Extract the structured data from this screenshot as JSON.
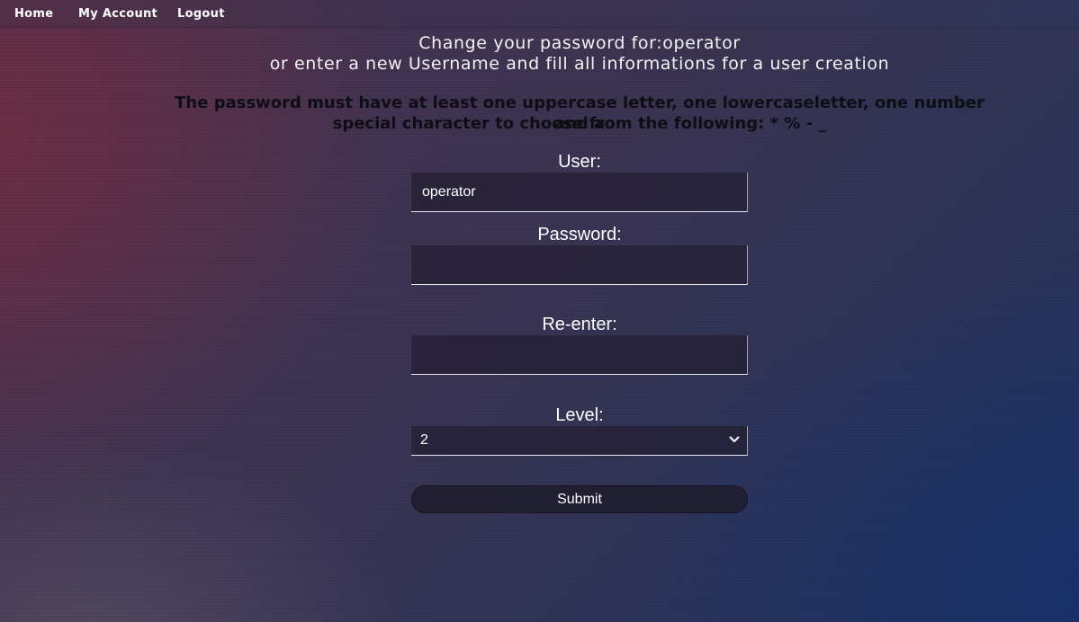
{
  "nav": {
    "home": "Home",
    "account": "My Account",
    "logout": "Logout"
  },
  "header": {
    "line1": "Change your password for:operator",
    "line2": "or enter a new Username and fill all informations for a user creation"
  },
  "rules": {
    "line1": "The password must have at least one uppercase letter, one lowercaseletter, one number and a",
    "line2": "special character to choose from the following: * % - _"
  },
  "form": {
    "user_label": "User:",
    "user_value": "operator",
    "password_label": "Password:",
    "password_value": "",
    "reenter_label": "Re-enter:",
    "reenter_value": "",
    "level_label": "Level:",
    "level_value": "2",
    "submit_label": "Submit"
  },
  "icons": {
    "dropdown": "chevron-down-icon"
  },
  "colors": {
    "text": "#ffffff",
    "rules_text": "#0e0e14",
    "field_bg": "#2a2638"
  }
}
